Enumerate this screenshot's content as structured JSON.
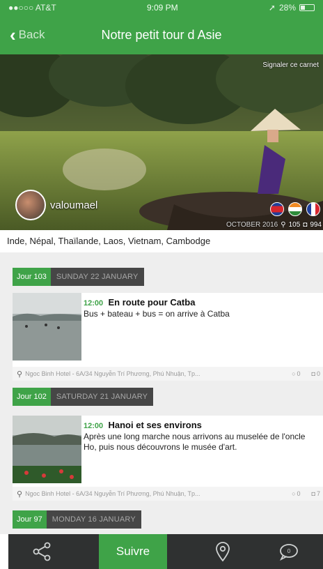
{
  "status": {
    "carrier": "●●○○○ AT&T",
    "time": "9:09 PM",
    "battery": "28%",
    "battery_level": 0.28
  },
  "nav": {
    "back_label": "Back",
    "title": "Notre petit tour d Asie"
  },
  "hero": {
    "report_label": "Signaler ce carnet",
    "author": "valoumael",
    "date": "OCTOBER 2016",
    "places_count": "105",
    "photos_count": "994",
    "flags": [
      "cambodia-flag",
      "india-flag",
      "france-flag"
    ]
  },
  "countries": "Inde, Népal, Thaïlande, Laos, Vietnam, Cambodge",
  "days": [
    {
      "number": "Jour 103",
      "date": "SUNDAY 22 JANUARY"
    },
    {
      "number": "Jour 102",
      "date": "SATURDAY 21 JANUARY"
    },
    {
      "number": "Jour 97",
      "date": "MONDAY 16 JANUARY"
    }
  ],
  "entries": [
    {
      "time": "12:00",
      "title": "En route pour Catba",
      "text": "Bus + bateau + bus = on arrive à Catba",
      "location": "Ngoc Binh Hotel - 6A/34 Nguyễn Trí Phương, Phú Nhuận, Tp...",
      "comments": "0",
      "photos": "0"
    },
    {
      "time": "12:00",
      "title": "Hanoi et ses environs",
      "text": "Après une long marche nous arrivons au muselée de l'oncle Ho, puis nous découvrons le musée d'art.",
      "location": "Ngoc Binh Hotel - 6A/34 Nguyễn Trí Phương, Phú Nhuận, Tp...",
      "comments": "0",
      "photos": "7"
    }
  ],
  "tabbar": {
    "follow_label": "Suivre",
    "icons": [
      "share-icon",
      "map-pin-icon",
      "comment-icon"
    ]
  },
  "colors": {
    "accent_green": "#3fa348",
    "dark_bar": "#2f3131",
    "date_badge": "#464646"
  }
}
